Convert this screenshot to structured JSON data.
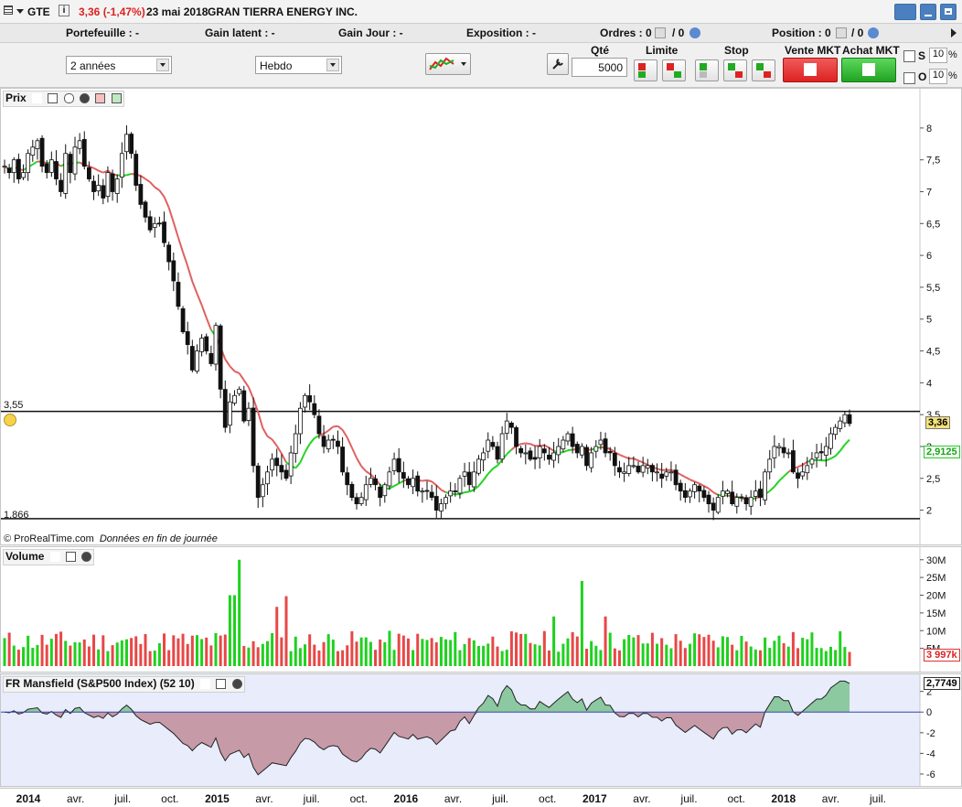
{
  "title_bar": {
    "symbol": "GTE",
    "last_change": "3,36 (-1,47%)",
    "date": "23 mai 2018",
    "company": "GRAN TIERRA ENERGY INC."
  },
  "info_bar": {
    "portefeuille": "Portefeuille : -",
    "gain_latent": "Gain latent : -",
    "gain_jour": "Gain Jour : -",
    "exposition": "Exposition : -",
    "ordres_label": "Ordres : 0",
    "ordres_slash": "/ 0",
    "position_label": "Position : 0",
    "position_slash": "/ 0"
  },
  "toolbar": {
    "period": "2 années",
    "interval": "Hebdo",
    "qty_label": "Qté",
    "qty_value": "5000",
    "limite_label": "Limite",
    "stop_label": "Stop",
    "vente_label": "Vente MKT",
    "achat_label": "Achat MKT",
    "s_label": "S",
    "o_label": "O",
    "s_pct": "10",
    "o_pct": "10",
    "pct_sign": "%"
  },
  "price_panel": {
    "title": "Prix",
    "credit": "© ProRealTime.com",
    "credit_note": "Données en fin de journée",
    "line_upper_label": "3,55",
    "line_lower_label": "1,866",
    "last_price_tag": "3,36",
    "ma_tag": "2,9125",
    "y_ticks": [
      "8",
      "7,5",
      "7",
      "6,5",
      "6",
      "5,5",
      "5",
      "4,5",
      "4",
      "3,5",
      "3",
      "2,5",
      "2"
    ]
  },
  "volume_panel": {
    "title": "Volume",
    "last_volume_tag": "3 997k",
    "y_ticks": [
      "30M",
      "25M",
      "20M",
      "15M",
      "10M",
      "5M"
    ]
  },
  "mansfield_panel": {
    "title": "FR Mansfield (S&P500 Index) (52 10)",
    "last_value_tag": "2,7749",
    "y_ticks": [
      "2",
      "0",
      "-2",
      "-4",
      "-6"
    ]
  },
  "x_axis": {
    "labels": [
      "2014",
      "avr.",
      "juil.",
      "oct.",
      "2015",
      "avr.",
      "juil.",
      "oct.",
      "2016",
      "avr.",
      "juil.",
      "oct.",
      "2017",
      "avr.",
      "juil.",
      "oct.",
      "2018",
      "avr.",
      "juil."
    ],
    "bold": [
      "2014",
      "2015",
      "2016",
      "2017",
      "2018"
    ]
  },
  "colors": {
    "up": "#1fd11f",
    "down": "#e84747",
    "ma_red": "#e06060",
    "ma_green": "#22d422",
    "mansfield_pos": "#8cc9a0",
    "mansfield_neg": "#c79aa8",
    "mansfield_bg": "#e8ecfb"
  },
  "chart_data": {
    "type": "candlestick",
    "price_series_weekly_close_approx": [
      7.4,
      7.3,
      7.5,
      7.2,
      7.3,
      7.6,
      7.7,
      7.8,
      7.4,
      7.3,
      7.5,
      7.2,
      7.0,
      7.6,
      7.3,
      7.7,
      7.8,
      7.4,
      7.2,
      7.0,
      7.1,
      6.9,
      7.3,
      7.0,
      7.2,
      7.6,
      7.9,
      7.6,
      7.1,
      6.8,
      6.6,
      6.4,
      6.5,
      6.5,
      6.2,
      5.9,
      5.6,
      5.2,
      4.8,
      4.6,
      4.2,
      4.5,
      4.7,
      4.5,
      4.3,
      4.9,
      3.9,
      3.3,
      3.7,
      3.8,
      3.9,
      3.4,
      3.6,
      2.7,
      2.2,
      2.4,
      2.6,
      2.8,
      2.7,
      2.6,
      2.5,
      2.9,
      3.2,
      3.6,
      3.8,
      3.7,
      3.5,
      3.2,
      3.0,
      3.1,
      3.1,
      3.0,
      2.6,
      2.4,
      2.2,
      2.1,
      2.2,
      2.4,
      2.5,
      2.4,
      2.2,
      2.4,
      2.6,
      2.8,
      2.6,
      2.5,
      2.4,
      2.5,
      2.3,
      2.3,
      2.3,
      2.2,
      2.0,
      2.1,
      2.2,
      2.3,
      2.3,
      2.5,
      2.6,
      2.4,
      2.6,
      2.8,
      2.9,
      3.1,
      3.0,
      2.8,
      3.2,
      3.4,
      3.3,
      3.0,
      2.9,
      2.9,
      2.8,
      2.8,
      3.0,
      2.9,
      2.8,
      2.9,
      3.0,
      3.1,
      3.2,
      3.0,
      2.9,
      3.0,
      2.7,
      2.9,
      3.0,
      3.1,
      2.9,
      2.9,
      2.7,
      2.6,
      2.6,
      2.7,
      2.7,
      2.6,
      2.7,
      2.7,
      2.6,
      2.6,
      2.5,
      2.6,
      2.6,
      2.4,
      2.3,
      2.2,
      2.3,
      2.4,
      2.3,
      2.2,
      2.1,
      2.0,
      2.2,
      2.3,
      2.3,
      2.1,
      2.2,
      2.2,
      2.1,
      2.2,
      2.3,
      2.2,
      2.6,
      2.8,
      3.0,
      3.0,
      2.9,
      2.9,
      2.6,
      2.5,
      2.6,
      2.7,
      2.8,
      2.9,
      2.9,
      3.0,
      3.2,
      3.3,
      3.4,
      3.5,
      3.36
    ],
    "moving_average_last": 2.9125,
    "horizontal_lines": [
      3.55,
      1.866
    ],
    "price_ylim": [
      1.75,
      8.3
    ],
    "volume_ylim_millions": [
      0,
      32
    ],
    "mansfield_ylim": [
      -6.8,
      3.3
    ],
    "mansfield_last": 2.7749
  }
}
